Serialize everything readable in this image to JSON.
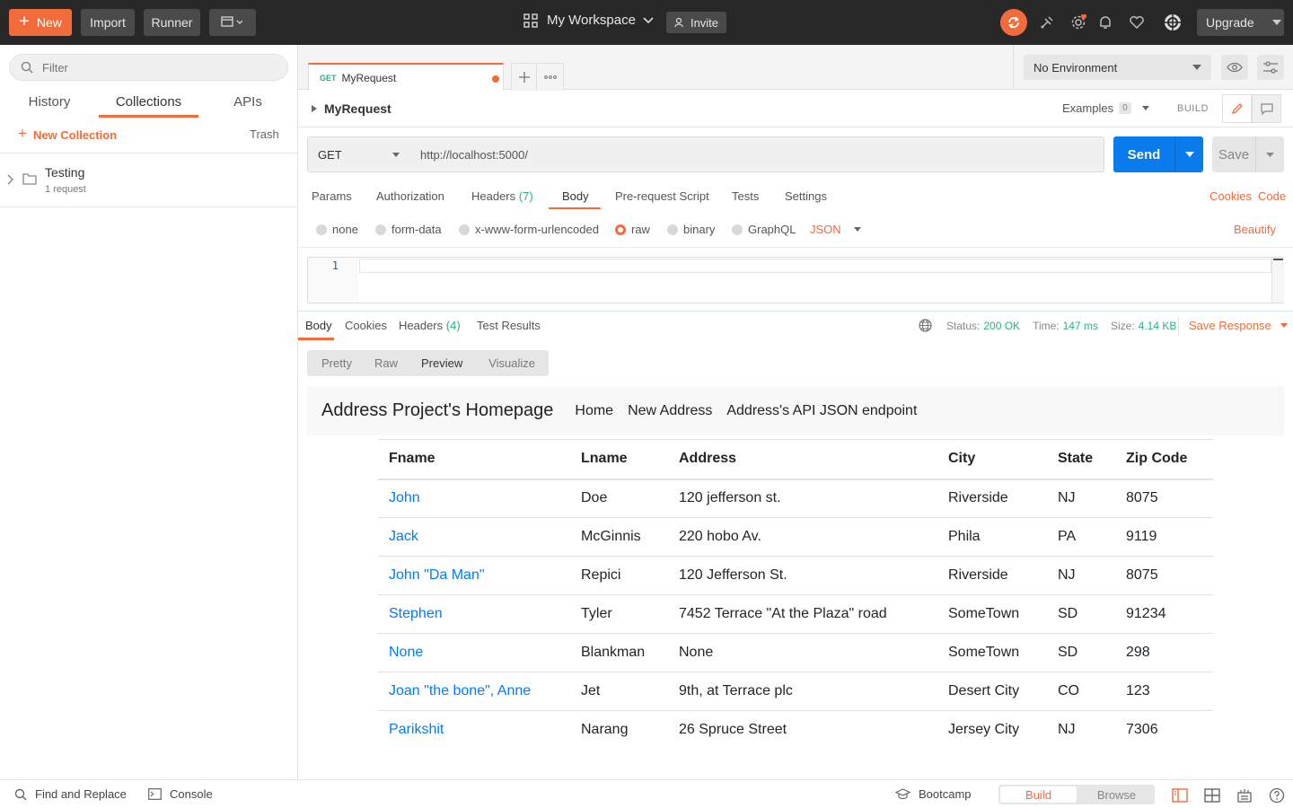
{
  "topbar": {
    "new_label": "New",
    "import_label": "Import",
    "runner_label": "Runner",
    "workspace": "My Workspace",
    "invite": "Invite",
    "upgrade": "Upgrade"
  },
  "sidebar": {
    "filter_placeholder": "Filter",
    "tabs": [
      "History",
      "Collections",
      "APIs"
    ],
    "active_tab": "Collections",
    "new_collection": "New Collection",
    "trash": "Trash",
    "collection": {
      "name": "Testing",
      "meta": "1 request"
    }
  },
  "tabbar": {
    "tab_method": "GET",
    "tab_name": "MyRequest",
    "environment": "No Environment"
  },
  "request": {
    "name": "MyRequest",
    "examples_label": "Examples",
    "examples_count": "0",
    "build_label": "BUILD",
    "method": "GET",
    "url": "http://localhost:5000/",
    "send": "Send",
    "save": "Save",
    "tabs": {
      "params": "Params",
      "authorization": "Authorization",
      "headers": "Headers",
      "headers_count": "(7)",
      "body": "Body",
      "prerequest": "Pre-request Script",
      "tests": "Tests",
      "settings": "Settings"
    },
    "cookies": "Cookies",
    "code": "Code",
    "body_types": [
      "none",
      "form-data",
      "x-www-form-urlencoded",
      "raw",
      "binary",
      "GraphQL"
    ],
    "selected_body_type": "raw",
    "format": "JSON",
    "beautify": "Beautify",
    "editor_line": "1"
  },
  "response": {
    "tabs": {
      "body": "Body",
      "cookies": "Cookies",
      "headers": "Headers",
      "headers_count": "(4)",
      "test_results": "Test Results"
    },
    "status_label": "Status:",
    "status": "200 OK",
    "time_label": "Time:",
    "time": "147 ms",
    "size_label": "Size:",
    "size": "4.14 KB",
    "save_response": "Save Response",
    "views": [
      "Pretty",
      "Raw",
      "Preview",
      "Visualize"
    ],
    "active_view": "Preview"
  },
  "preview": {
    "brand": "Address Project's Homepage",
    "nav": [
      "Home",
      "New Address",
      "Address's API JSON endpoint"
    ],
    "columns": [
      "Fname",
      "Lname",
      "Address",
      "City",
      "State",
      "Zip Code"
    ],
    "rows": [
      [
        "John",
        "Doe",
        "120 jefferson st.",
        "Riverside",
        "NJ",
        "8075"
      ],
      [
        "Jack",
        "McGinnis",
        "220 hobo Av.",
        "Phila",
        "PA",
        "9119"
      ],
      [
        "John \"Da Man\"",
        "Repici",
        "120 Jefferson St.",
        "Riverside",
        "NJ",
        "8075"
      ],
      [
        "Stephen",
        "Tyler",
        "7452 Terrace \"At the Plaza\" road",
        "SomeTown",
        "SD",
        "91234"
      ],
      [
        "None",
        "Blankman",
        "None",
        "SomeTown",
        "SD",
        "298"
      ],
      [
        "Joan \"the bone\", Anne",
        "Jet",
        "9th, at Terrace plc",
        "Desert City",
        "CO",
        "123"
      ],
      [
        "Parikshit",
        "Narang",
        "26 Spruce Street",
        "Jersey City",
        "NJ",
        "7306"
      ]
    ]
  },
  "footer": {
    "find_replace": "Find and Replace",
    "console": "Console",
    "bootcamp": "Bootcamp",
    "build": "Build",
    "browse": "Browse"
  },
  "colors": {
    "accent": "#f26b3a",
    "send_blue": "#097bed",
    "success": "#26b47f",
    "topbar": "#282828"
  }
}
